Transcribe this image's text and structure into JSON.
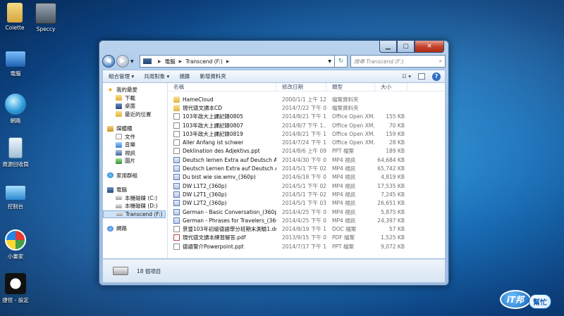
{
  "desktop_icons": [
    {
      "label": "Colette"
    },
    {
      "label": "Speccy"
    },
    {
      "label": "電腦"
    },
    {
      "label": "網路"
    },
    {
      "label": "資源回收筒"
    },
    {
      "label": "控制台"
    },
    {
      "label": "小畫家"
    },
    {
      "label": "捷徑 - 設定"
    }
  ],
  "window": {
    "address": {
      "root": "電腦",
      "location": "Transcend (F:)"
    },
    "search_placeholder": "搜尋 Transcend (F:)",
    "toolbar": {
      "organize": "組合管理 ▾",
      "share": "共用對象 ▾",
      "burn": "燒錄",
      "new_folder": "新增資料夾"
    },
    "nav": {
      "favorites": {
        "title": "我的最愛",
        "items": [
          "下載",
          "桌面",
          "最近的位置"
        ]
      },
      "libraries": {
        "title": "媒體櫃",
        "items": [
          "文件",
          "音樂",
          "視訊",
          "圖片"
        ]
      },
      "homegroup": {
        "title": "家用群組"
      },
      "computer": {
        "title": "電腦",
        "items": [
          "本機磁碟 (C:)",
          "本機磁碟 (D:)",
          "Transcend (F:)"
        ]
      },
      "network": {
        "title": "網路"
      }
    },
    "columns": {
      "name": "名稱",
      "date": "修改日期",
      "type": "類型",
      "size": "大小"
    },
    "files": [
      {
        "name": "HameCloud",
        "date": "2000/1/1 上午 12...",
        "type": "檔案資料夾",
        "size": "",
        "kind": "folder"
      },
      {
        "name": "現代德文讀本CD",
        "date": "2014/7/22 下午 0...",
        "type": "檔案資料夾",
        "size": "",
        "kind": "folder"
      },
      {
        "name": "103年政大上課記錄0805",
        "date": "2014/8/21 下午 1...",
        "type": "Office Open XM...",
        "size": "155 KB",
        "kind": "docx"
      },
      {
        "name": "103年政大上課記錄0807",
        "date": "2014/8/7 下午 1...",
        "type": "Office Open XM...",
        "size": "70 KB",
        "kind": "docx"
      },
      {
        "name": "103年政大上課記錄0819",
        "date": "2014/8/21 下午 1...",
        "type": "Office Open XM...",
        "size": "159 KB",
        "kind": "docx"
      },
      {
        "name": "Aller Anfang ist schwer",
        "date": "2014/7/24 下午 1...",
        "type": "Office Open XM...",
        "size": "28 KB",
        "kind": "docx"
      },
      {
        "name": "Deklination des Adjektivs.ppt",
        "date": "2014/8/6 上午 09...",
        "type": "PPT 檔案",
        "size": "189 KB",
        "kind": "ppt"
      },
      {
        "name": "Deutsch lernen Extra auf Deutsch Absc...",
        "date": "2014/4/30 下午 0...",
        "type": "MP4 視訊",
        "size": "64,684 KB",
        "kind": "mp4"
      },
      {
        "name": "Deutsch Lernen Extra auf Deutsch Absc...",
        "date": "2014/5/1 下午 02...",
        "type": "MP4 視訊",
        "size": "65,742 KB",
        "kind": "mp4"
      },
      {
        "name": "Du bist wie sie.wmv_(360p)",
        "date": "2014/6/18 下午 0...",
        "type": "MP4 視訊",
        "size": "4,819 KB",
        "kind": "mp4"
      },
      {
        "name": "DW L1T2_(360p)",
        "date": "2014/5/1 下午 02...",
        "type": "MP4 視訊",
        "size": "17,535 KB",
        "kind": "mp4"
      },
      {
        "name": "DW L2T1_(360p)",
        "date": "2014/5/1 下午 02...",
        "type": "MP4 視訊",
        "size": "7,245 KB",
        "kind": "mp4"
      },
      {
        "name": "DW L2T2_(360p)",
        "date": "2014/5/1 下午 03...",
        "type": "MP4 視訊",
        "size": "26,651 KB",
        "kind": "mp4"
      },
      {
        "name": "German - Basic Conversation_(360p) - ...",
        "date": "2014/4/25 下午 0...",
        "type": "MP4 視訊",
        "size": "5,875 KB",
        "kind": "mp4"
      },
      {
        "name": "German - Phrases for Travelers_(360p) ...",
        "date": "2014/4/25 下午 0...",
        "type": "MP4 視訊",
        "size": "24,397 KB",
        "kind": "mp4"
      },
      {
        "name": "景豐103年初級德語學分班期末測驗1.doc",
        "date": "2014/8/19 下午 1...",
        "type": "DOC 檔案",
        "size": "57 KB",
        "kind": "docx"
      },
      {
        "name": "現代德文讀本練習解答.pdf",
        "date": "2013/9/15 下午 0...",
        "type": "PDF 檔案",
        "size": "1,525 KB",
        "kind": "pdf"
      },
      {
        "name": "德語警介Powerpoint.ppt",
        "date": "2014/7/17 下午 1...",
        "type": "PPT 檔案",
        "size": "9,072 KB",
        "kind": "ppt"
      }
    ],
    "status": "18 個項目"
  },
  "watermark": {
    "main": "iT邦",
    "sub": "幫忙"
  }
}
